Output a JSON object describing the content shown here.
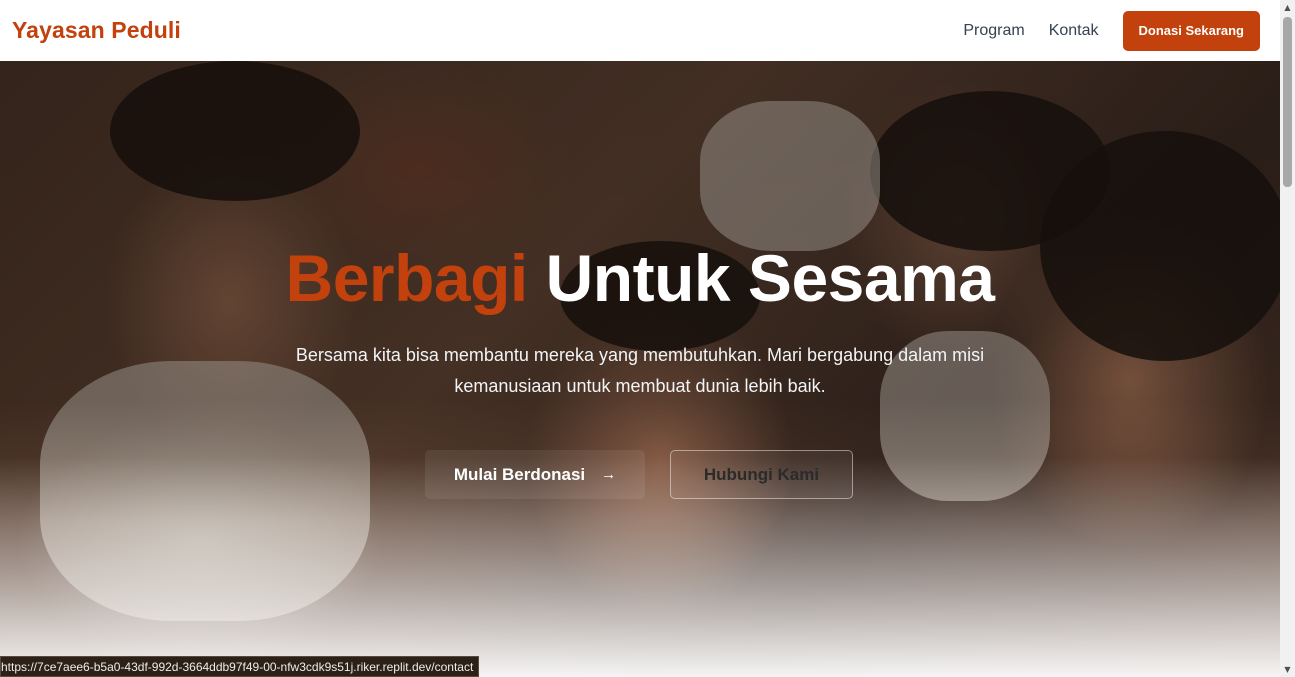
{
  "navbar": {
    "brand": "Yayasan Peduli",
    "links": [
      "Program",
      "Kontak"
    ],
    "cta_label": "Donasi Sekarang"
  },
  "hero": {
    "title_accent": "Berbagi",
    "title_rest": "Untuk Sesama",
    "subtitle": "Bersama kita bisa membantu mereka yang membutuhkan. Mari bergabung dalam misi kemanusiaan untuk membuat dunia lebih baik.",
    "primary_button": "Mulai Berdonasi",
    "primary_icon": "arrow-right-icon",
    "secondary_button": "Hubungi Kami"
  },
  "status_bar": {
    "url": "https://7ce7aee6-b5a0-43df-992d-3664ddb97f49-00-nfw3cdk9s51j.riker.replit.dev/contact"
  },
  "colors": {
    "brand": "#c2410c",
    "nav_text": "#374151"
  }
}
